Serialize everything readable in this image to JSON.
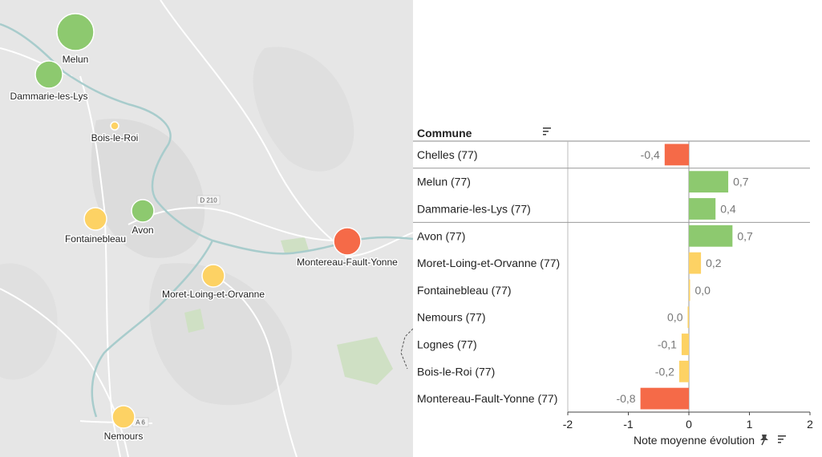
{
  "colors": {
    "green": "#8dc96f",
    "yellow": "#fdd264",
    "red": "#f56a48",
    "map_bg": "#e6e6e6",
    "river": "#a8cccc",
    "road": "#ffffff"
  },
  "map": {
    "road_labels": [
      "D 210",
      "A 6"
    ],
    "cities": [
      {
        "name": "Melun",
        "color": "green",
        "size": "large"
      },
      {
        "name": "Dammarie-les-Lys",
        "color": "green",
        "size": "medium"
      },
      {
        "name": "Bois-le-Roi",
        "color": "yellow",
        "size": "tiny"
      },
      {
        "name": "Fontainebleau",
        "color": "yellow",
        "size": "small"
      },
      {
        "name": "Avon",
        "color": "green",
        "size": "small"
      },
      {
        "name": "Montereau-Fault-Yonne",
        "color": "red",
        "size": "medium"
      },
      {
        "name": "Moret-Loing-et-Orvanne",
        "color": "yellow",
        "size": "small"
      },
      {
        "name": "Nemours",
        "color": "yellow",
        "size": "small"
      }
    ]
  },
  "chart_data": {
    "type": "bar",
    "orientation": "horizontal",
    "header": "Commune",
    "xlabel": "Note moyenne évolution",
    "xlim": [
      -2,
      2
    ],
    "xticks": [
      "-2",
      "-1",
      "0",
      "1",
      "2"
    ],
    "categories": [
      "Chelles (77)",
      "Melun (77)",
      "Dammarie-les-Lys (77)",
      "Avon (77)",
      "Moret-Loing-et-Orvanne (77)",
      "Fontainebleau (77)",
      "Nemours (77)",
      "Lognes (77)",
      "Bois-le-Roi (77)",
      "Montereau-Fault-Yonne (77)"
    ],
    "values": [
      -0.4,
      0.65,
      0.44,
      0.72,
      0.2,
      0.02,
      -0.02,
      -0.12,
      -0.16,
      -0.8
    ],
    "value_labels": [
      "-0,4",
      "0,7",
      "0,4",
      "0,7",
      "0,2",
      "0,0",
      "0,0",
      "-0,1",
      "-0,2",
      "-0,8"
    ],
    "colors": [
      "red",
      "green",
      "green",
      "green",
      "yellow",
      "yellow",
      "yellow",
      "yellow",
      "yellow",
      "red"
    ],
    "grid": false
  }
}
